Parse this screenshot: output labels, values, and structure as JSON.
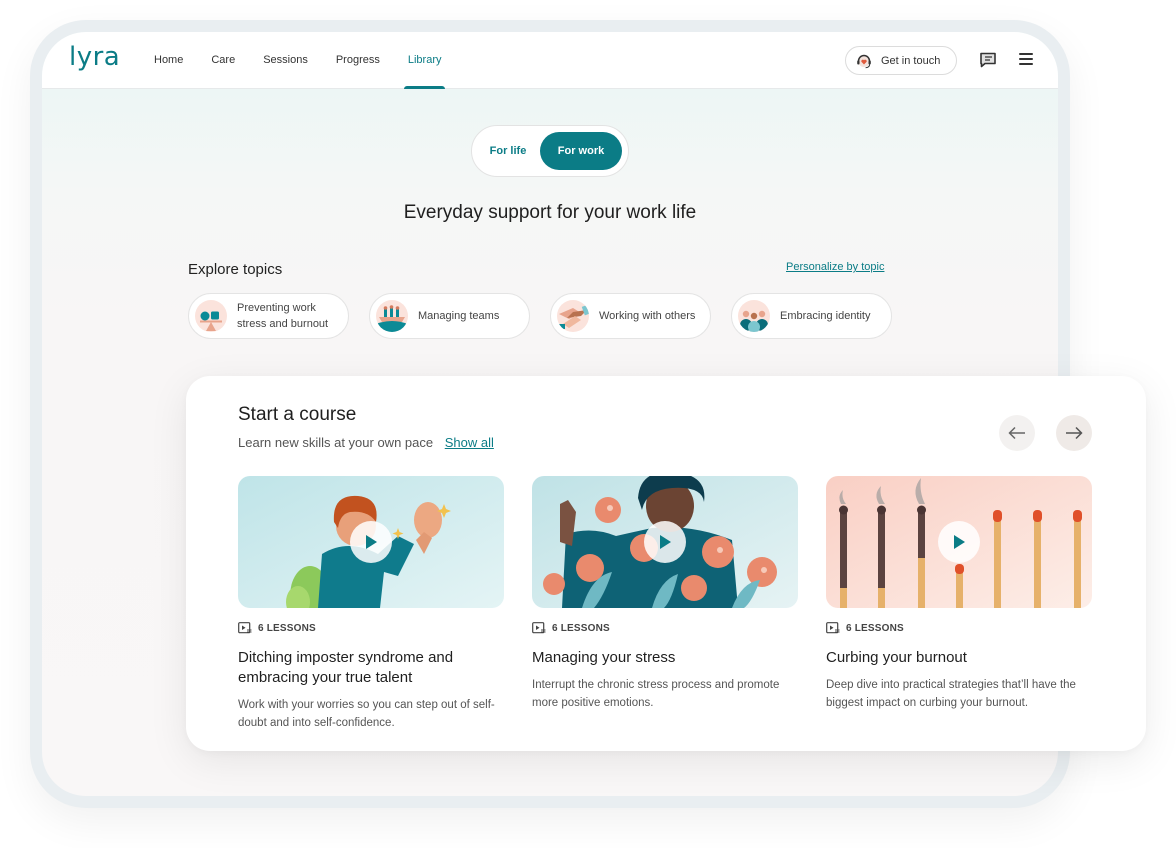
{
  "nav": {
    "logo": "lyra",
    "links": [
      {
        "label": "Home",
        "active": false
      },
      {
        "label": "Care",
        "active": false
      },
      {
        "label": "Sessions",
        "active": false
      },
      {
        "label": "Progress",
        "active": false
      },
      {
        "label": "Library",
        "active": true
      }
    ],
    "get_in_touch": "Get in touch",
    "icons": {
      "support": "headset-heart-icon",
      "messages": "chat-icon",
      "menu": "hamburger-menu-icon"
    }
  },
  "toggle": {
    "options": [
      "For life",
      "For work"
    ],
    "selected": "For work"
  },
  "hero": {
    "title": "Everyday support for your work life"
  },
  "explore": {
    "title": "Explore topics",
    "personalize_link": "Personalize by topic",
    "topics": [
      {
        "label": "Preventing work stress and burnout",
        "icon": "balance-scale-icon"
      },
      {
        "label": "Managing teams",
        "icon": "team-boat-icon"
      },
      {
        "label": "Working with others",
        "icon": "stacked-hands-icon"
      },
      {
        "label": "Embracing identity",
        "icon": "group-people-icon"
      }
    ]
  },
  "courses": {
    "title": "Start a course",
    "subtitle": "Learn new skills at your own pace",
    "show_all": "Show all",
    "items": [
      {
        "lessons": "6 LESSONS",
        "title": "Ditching imposter syndrome and embracing your true talent",
        "description": "Work with your worries so you can step out of self-doubt and into self-confidence."
      },
      {
        "lessons": "6 LESSONS",
        "title": "Managing your stress",
        "description": "Interrupt the chronic stress process and promote more positive emotions."
      },
      {
        "lessons": "6 LESSONS",
        "title": "Curbing your burnout",
        "description": "Deep dive into practical strategies that’ll have the biggest impact on curbing your burnout."
      }
    ]
  },
  "colors": {
    "brand": "#0b7c86",
    "accent_coral": "#e88a6e"
  }
}
